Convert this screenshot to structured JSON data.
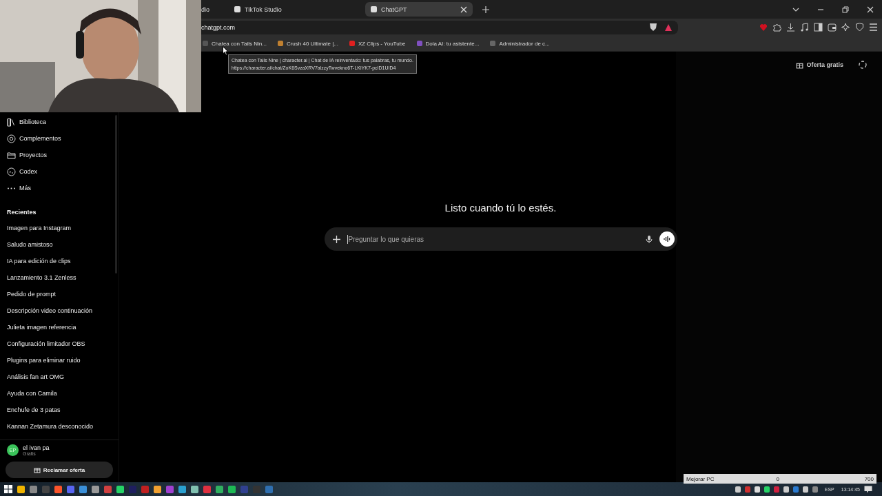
{
  "tabs": [
    {
      "label": "dio",
      "selected": false
    },
    {
      "label": "TikTok Studio",
      "selected": false
    },
    {
      "label": "ChatGPT",
      "selected": true
    }
  ],
  "address": {
    "value": "chatgpt.com"
  },
  "bookmarks": [
    "Chatea con Tails Nin...",
    "Crush 40 Ultimate |...",
    "XZ Clips - YouTube",
    "Dola AI: tu asistente...",
    "Administrador de c..."
  ],
  "tooltip": {
    "title": "Chatea con Tails Nine | character.ai | Chat de IA reinventado: tus palabras, tu mundo.",
    "url": "https://character.ai/chat/ZoK6SvzaXRV7alzzyTwvekno6T-LKiYK7-pcID1UID4"
  },
  "sidebar": {
    "items": [
      "Biblioteca",
      "Complementos",
      "Proyectos",
      "Codex",
      "Más"
    ],
    "recents_heading": "Recientes",
    "recents": [
      "Imagen para Instagram",
      "Saludo amistoso",
      "IA para edición de clips",
      "Lanzamiento 3.1 Zenless",
      "Pedido de prompt",
      "Descripción video continuación",
      "Julieta imagen referencia",
      "Configuración limitador OBS",
      "Plugins para eliminar ruido",
      "Análisis fan art OMG",
      "Ayuda con Camila",
      "Enchufe de 3 patas",
      "Kannan Zetamura desconocido"
    ],
    "user": {
      "initials": "EP",
      "name": "el ivan pa",
      "plan": "Gratis"
    },
    "claim_button": "Reclamar oferta"
  },
  "header": {
    "offer": "Oferta gratis"
  },
  "main": {
    "heading": "Listo cuando tú lo estés.",
    "composer": {
      "placeholder": "Preguntar lo que quieras"
    }
  },
  "widget": {
    "label": "Mejorar PC",
    "value": "0",
    "max": "700"
  },
  "tray": {
    "language": "ESP",
    "time": "13:14:45"
  }
}
